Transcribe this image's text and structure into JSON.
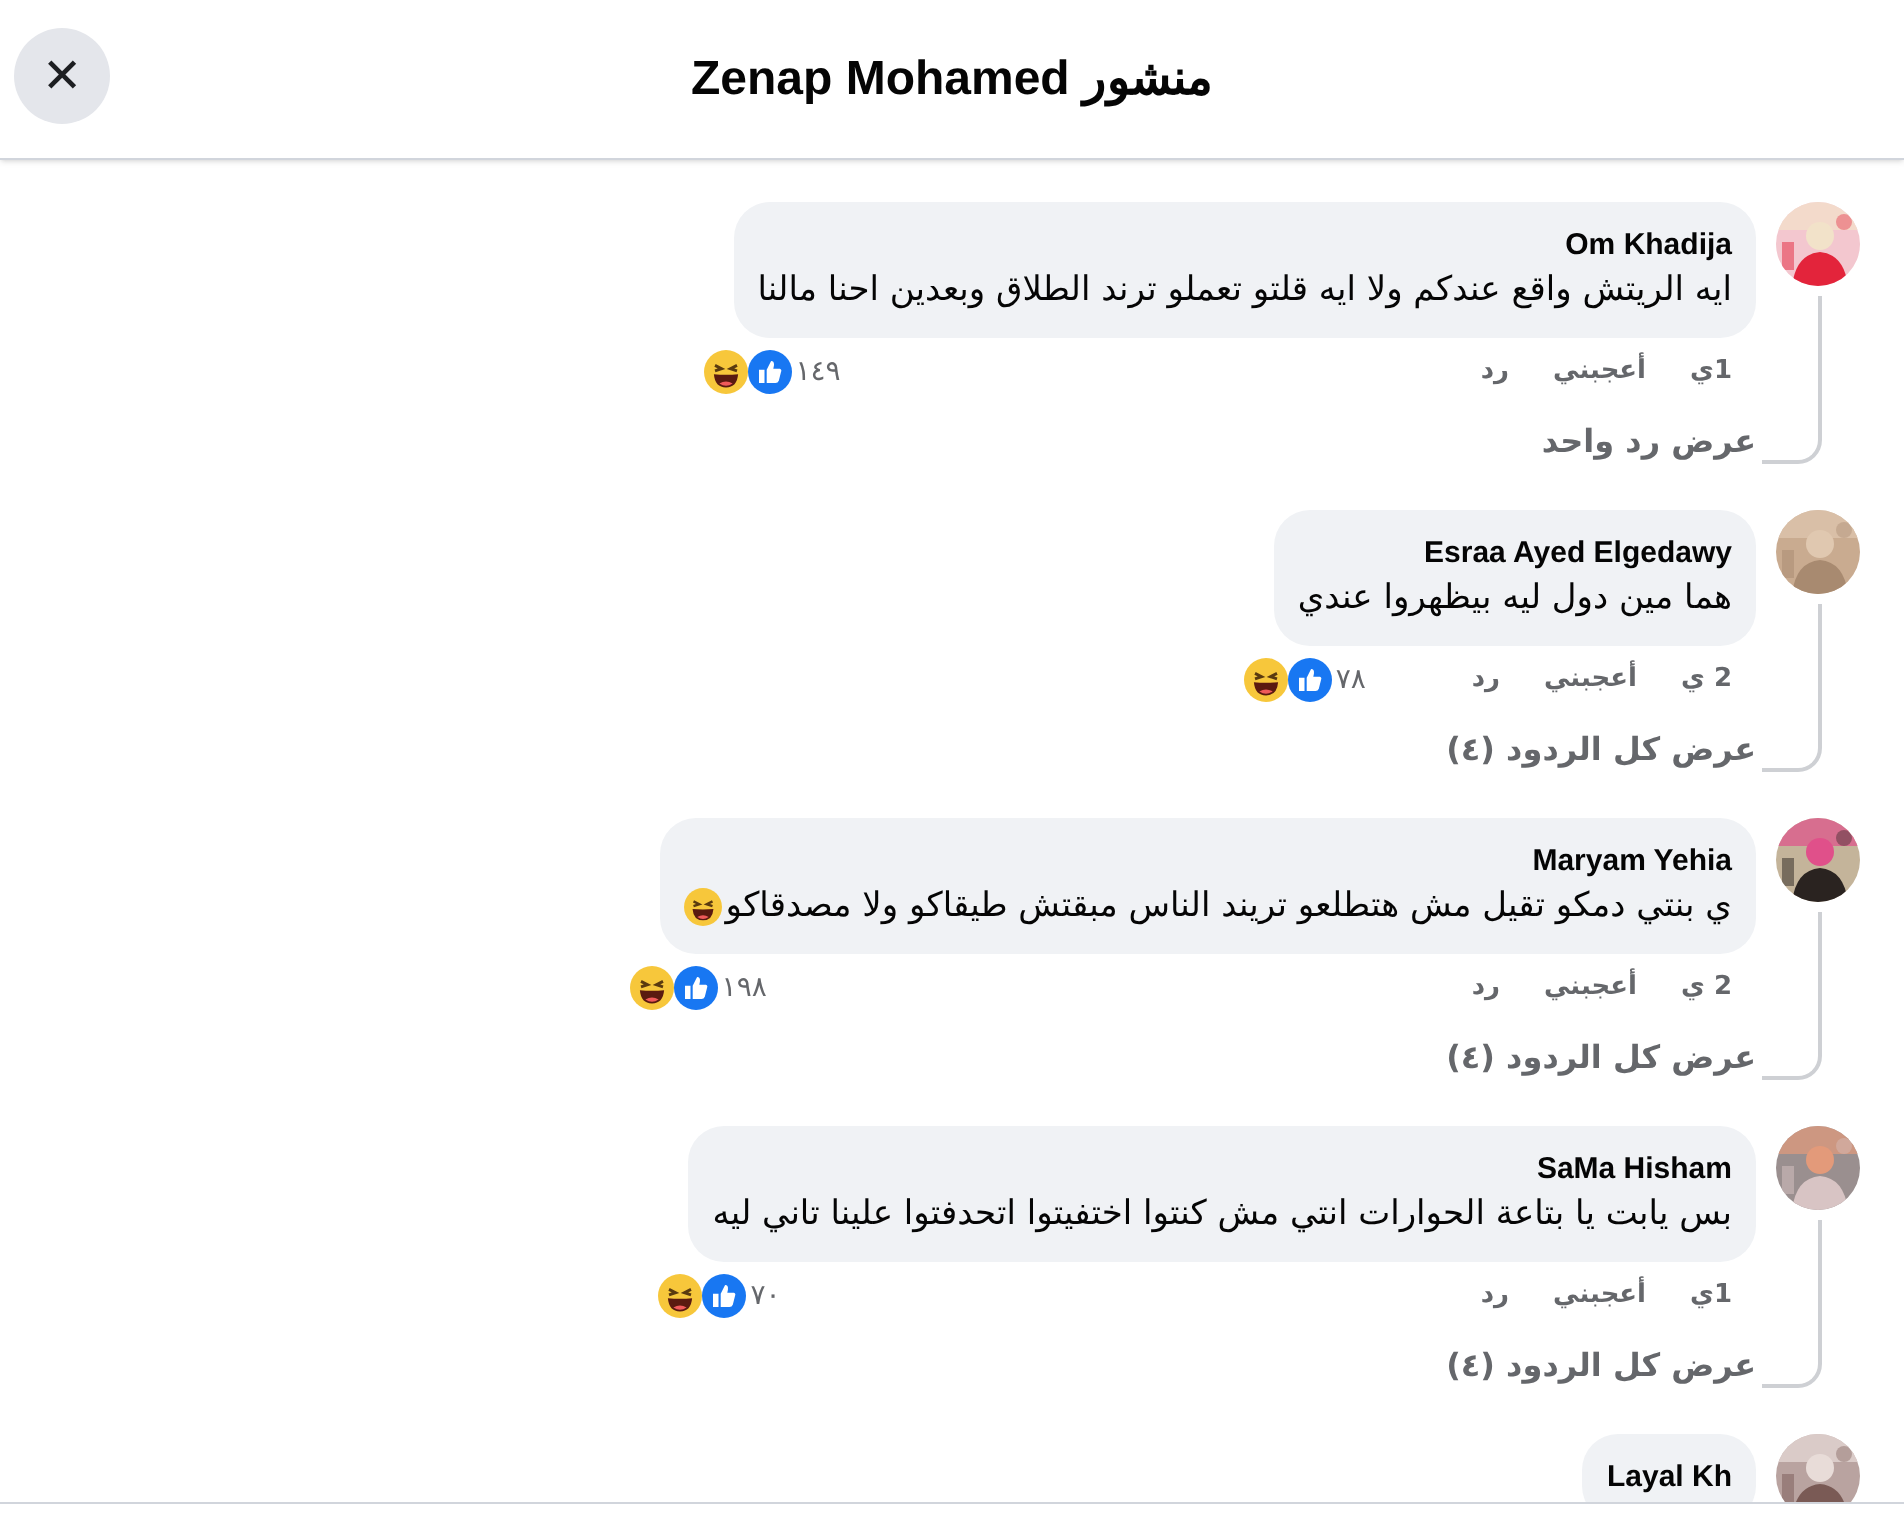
{
  "header": {
    "title": "منشور Zenap Mohamed",
    "close_label": "✕"
  },
  "comments": [
    {
      "author": "Om Khadija",
      "text": "ايه الريتش واقع عندكم ولا ايه قلتو تعملو ترند الطلاق وبعدين احنا مالنا",
      "ends_with_emoji": false,
      "time": "1ي",
      "like_label": "أعجبني",
      "reply_label": "رد",
      "reaction_count": "١٤٩",
      "view_replies": "عرض رد واحد"
    },
    {
      "author": "Esraa Ayed Elgedawy",
      "text": "هما مين دول ليه بيظهروا عندي",
      "ends_with_emoji": false,
      "time": "2 ي",
      "like_label": "أعجبني",
      "reply_label": "رد",
      "reaction_count": "٧٨",
      "view_replies": "عرض كل الردود (٤)"
    },
    {
      "author": "Maryam Yehia",
      "text": "ي بنتي دمكو تقيل مش هتطلعو تريند الناس مبقتش طيقاكو ولا مصدقاكو",
      "ends_with_emoji": true,
      "time": "2 ي",
      "like_label": "أعجبني",
      "reply_label": "رد",
      "reaction_count": "١٩٨",
      "view_replies": "عرض كل الردود (٤)"
    },
    {
      "author": "SaMa Hisham",
      "text": "بس يابت يا بتاعة الحوارات انتي مش كنتوا اختفيتوا اتحدفتوا علينا تاني ليه",
      "ends_with_emoji": false,
      "time": "1ي",
      "like_label": "أعجبني",
      "reply_label": "رد",
      "reaction_count": "٧٠",
      "view_replies": "عرض كل الردود (٤)"
    },
    {
      "author": "Layal Kh"
    }
  ]
}
